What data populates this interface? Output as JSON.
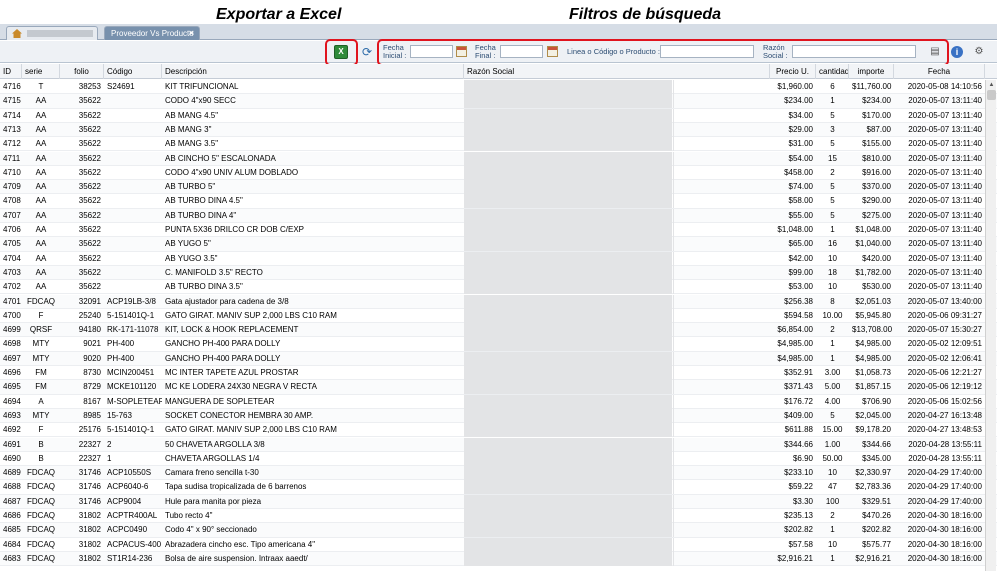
{
  "annotations": {
    "export": "Exportar a Excel",
    "filters": "Filtros de búsqueda"
  },
  "tabs": {
    "home_label": "",
    "active_label": "Proveedor Vs Producto",
    "close_glyph": "×"
  },
  "toolbar": {
    "excel_glyph": "X",
    "refresh_glyph": "⟳",
    "fecha_inicial_label": "Fecha Inicial :",
    "fecha_final_label": "Fecha Final :",
    "linea_label": "Linea o Código o Producto :",
    "razon_label": "Razón Social :",
    "fecha_inicial_value": "",
    "fecha_final_value": "",
    "linea_value": "",
    "razon_value": "",
    "info_glyph": "i"
  },
  "columns": [
    "ID",
    "serie",
    "folio",
    "Código",
    "Descripción",
    "Razón Social",
    "Precio U.",
    "cantidad",
    "importe",
    "Fecha"
  ],
  "rows": [
    [
      "4716",
      "T",
      "38253",
      "S24691",
      "KIT TRIFUNCIONAL",
      "$1,960.00",
      "6",
      "$11,760.00",
      "2020-05-08 14:10:56"
    ],
    [
      "4715",
      "AA",
      "35622",
      "",
      "CODO 4\"x90 SECC",
      "$234.00",
      "1",
      "$234.00",
      "2020-05-07 13:11:40"
    ],
    [
      "4714",
      "AA",
      "35622",
      "",
      "AB MANG 4.5\"",
      "$34.00",
      "5",
      "$170.00",
      "2020-05-07 13:11:40"
    ],
    [
      "4713",
      "AA",
      "35622",
      "",
      "AB MANG 3\"",
      "$29.00",
      "3",
      "$87.00",
      "2020-05-07 13:11:40"
    ],
    [
      "4712",
      "AA",
      "35622",
      "",
      "AB MANG 3.5\"",
      "$31.00",
      "5",
      "$155.00",
      "2020-05-07 13:11:40"
    ],
    [
      "4711",
      "AA",
      "35622",
      "",
      "AB CINCHO 5\" ESCALONADA",
      "$54.00",
      "15",
      "$810.00",
      "2020-05-07 13:11:40"
    ],
    [
      "4710",
      "AA",
      "35622",
      "",
      "CODO 4\"x90 UNIV ALUM DOBLADO",
      "$458.00",
      "2",
      "$916.00",
      "2020-05-07 13:11:40"
    ],
    [
      "4709",
      "AA",
      "35622",
      "",
      "AB TURBO 5\"",
      "$74.00",
      "5",
      "$370.00",
      "2020-05-07 13:11:40"
    ],
    [
      "4708",
      "AA",
      "35622",
      "",
      "AB TURBO DINA 4.5\"",
      "$58.00",
      "5",
      "$290.00",
      "2020-05-07 13:11:40"
    ],
    [
      "4707",
      "AA",
      "35622",
      "",
      "AB TURBO DINA 4\"",
      "$55.00",
      "5",
      "$275.00",
      "2020-05-07 13:11:40"
    ],
    [
      "4706",
      "AA",
      "35622",
      "",
      "PUNTA 5X36 DRILCO CR DOB C/EXP",
      "$1,048.00",
      "1",
      "$1,048.00",
      "2020-05-07 13:11:40"
    ],
    [
      "4705",
      "AA",
      "35622",
      "",
      "AB YUGO 5\"",
      "$65.00",
      "16",
      "$1,040.00",
      "2020-05-07 13:11:40"
    ],
    [
      "4704",
      "AA",
      "35622",
      "",
      "AB YUGO 3.5\"",
      "$42.00",
      "10",
      "$420.00",
      "2020-05-07 13:11:40"
    ],
    [
      "4703",
      "AA",
      "35622",
      "",
      "C. MANIFOLD 3.5\" RECTO",
      "$99.00",
      "18",
      "$1,782.00",
      "2020-05-07 13:11:40"
    ],
    [
      "4702",
      "AA",
      "35622",
      "",
      "AB TURBO DINA 3.5\"",
      "$53.00",
      "10",
      "$530.00",
      "2020-05-07 13:11:40"
    ],
    [
      "4701",
      "FDCAQ",
      "32091",
      "ACP19LB-3/8",
      "Gata ajustador para cadena de 3/8",
      "$256.38",
      "8",
      "$2,051.03",
      "2020-05-07 13:40:00"
    ],
    [
      "4700",
      "F",
      "25240",
      "5-151401Q-1",
      "GATO GIRAT. MANIV SUP 2,000 LBS C10 RAM",
      "$594.58",
      "10.00",
      "$5,945.80",
      "2020-05-06 09:31:27"
    ],
    [
      "4699",
      "QRSF",
      "94180",
      "RK-171-11078",
      "KIT, LOCK & HOOK REPLACEMENT",
      "$6,854.00",
      "2",
      "$13,708.00",
      "2020-05-07 15:30:27"
    ],
    [
      "4698",
      "MTY",
      "9021",
      "PH-400",
      "GANCHO PH-400 PARA DOLLY",
      "$4,985.00",
      "1",
      "$4,985.00",
      "2020-05-02 12:09:51"
    ],
    [
      "4697",
      "MTY",
      "9020",
      "PH-400",
      "GANCHO PH-400 PARA DOLLY",
      "$4,985.00",
      "1",
      "$4,985.00",
      "2020-05-02 12:06:41"
    ],
    [
      "4696",
      "FM",
      "8730",
      "MCIN200451",
      "MC INTER TAPETE AZUL PROSTAR",
      "$352.91",
      "3.00",
      "$1,058.73",
      "2020-05-06 12:21:27"
    ],
    [
      "4695",
      "FM",
      "8729",
      "MCKE101120",
      "MC KE LODERA 24X30 NEGRA V RECTA",
      "$371.43",
      "5.00",
      "$1,857.15",
      "2020-05-06 12:19:12"
    ],
    [
      "4694",
      "A",
      "8167",
      "M-SOPLETEAR",
      "MANGUERA DE SOPLETEAR",
      "$176.72",
      "4.00",
      "$706.90",
      "2020-05-06 15:02:56"
    ],
    [
      "4693",
      "MTY",
      "8985",
      "15-763",
      "SOCKET CONECTOR HEMBRA 30 AMP.",
      "$409.00",
      "5",
      "$2,045.00",
      "2020-04-27 16:13:48"
    ],
    [
      "4692",
      "F",
      "25176",
      "5-151401Q-1",
      "GATO GIRAT. MANIV SUP 2,000 LBS C10 RAM",
      "$611.88",
      "15.00",
      "$9,178.20",
      "2020-04-27 13:48:53"
    ],
    [
      "4691",
      "B",
      "22327",
      "2",
      "50 CHAVETA ARGOLLA 3/8",
      "$344.66",
      "1.00",
      "$344.66",
      "2020-04-28 13:55:11"
    ],
    [
      "4690",
      "B",
      "22327",
      "1",
      "CHAVETA ARGOLLAS 1/4",
      "$6.90",
      "50.00",
      "$345.00",
      "2020-04-28 13:55:11"
    ],
    [
      "4689",
      "FDCAQ",
      "31746",
      "ACP10550S",
      "Camara freno sencilla t-30",
      "$233.10",
      "10",
      "$2,330.97",
      "2020-04-29 17:40:00"
    ],
    [
      "4688",
      "FDCAQ",
      "31746",
      "ACP6040-6",
      "Tapa sudisa tropicalizada de 6 barrenos",
      "$59.22",
      "47",
      "$2,783.36",
      "2020-04-29 17:40:00"
    ],
    [
      "4687",
      "FDCAQ",
      "31746",
      "ACP9004",
      "Hule para manita por pieza",
      "$3.30",
      "100",
      "$329.51",
      "2020-04-29 17:40:00"
    ],
    [
      "4686",
      "FDCAQ",
      "31802",
      "ACPTR400AL",
      "Tubo recto 4\"",
      "$235.13",
      "2",
      "$470.26",
      "2020-04-30 18:16:00"
    ],
    [
      "4685",
      "FDCAQ",
      "31802",
      "ACPC0490",
      "Codo 4\" x 90° seccionado",
      "$202.82",
      "1",
      "$202.82",
      "2020-04-30 18:16:00"
    ],
    [
      "4684",
      "FDCAQ",
      "31802",
      "ACPACUS-400",
      "Abrazadera cincho esc. Tipo americana 4\"",
      "$57.58",
      "10",
      "$575.77",
      "2020-04-30 18:16:00"
    ],
    [
      "4683",
      "FDCAQ",
      "31802",
      "ST1R14-236",
      "Bolsa de aire suspension. Intraax aaedt/",
      "$2,916.21",
      "1",
      "$2,916.21",
      "2020-04-30 18:16:00"
    ]
  ]
}
